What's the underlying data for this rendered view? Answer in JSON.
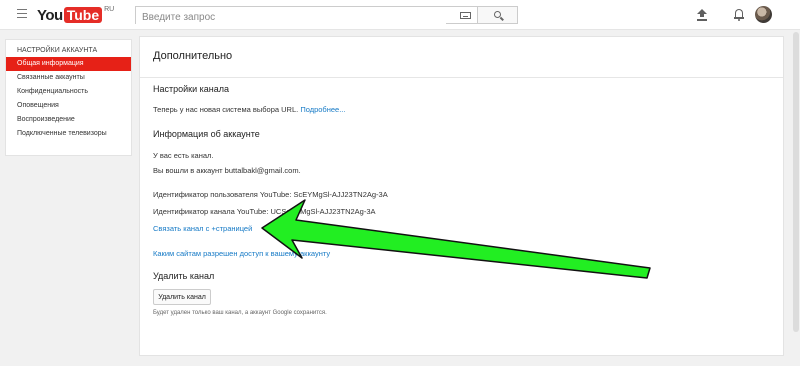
{
  "header": {
    "logo_you": "You",
    "logo_tube": "Tube",
    "logo_region": "RU",
    "search_placeholder": "Введите запрос",
    "icons": [
      "menu-icon",
      "keyboard-icon",
      "search-icon",
      "upload-icon",
      "notifications-icon"
    ]
  },
  "sidebar": {
    "title": "НАСТРОЙКИ АККАУНТА",
    "items": [
      {
        "label": "Общая информация",
        "active": true
      },
      {
        "label": "Связанные аккаунты"
      },
      {
        "label": "Конфиденциальность"
      },
      {
        "label": "Оповещения"
      },
      {
        "label": "Воспроизведение"
      },
      {
        "label": "Подключенные телевизоры"
      }
    ]
  },
  "main": {
    "title": "Дополнительно",
    "channel_settings": {
      "heading": "Настройки канала",
      "text": "Теперь у нас новая система выбора URL.",
      "link": "Подробнее..."
    },
    "account_info": {
      "heading": "Информация об аккаунте",
      "has_channel": "У вас есть канал.",
      "signed_in": "Вы вошли в аккаунт buttalbakl@gmail.com.",
      "user_id": "Идентификатор пользователя YouTube: ScEYMgSl-AJJ23TN2Ag-3A",
      "channel_id": "Идентификатор канала YouTube: UCScEYMgSl-AJJ23TN2Ag-3A",
      "link_channel": "Связать канал с +страницей",
      "sites_access": "Каким сайтам разрешен доступ к вашему аккаунту"
    },
    "delete": {
      "heading": "Удалить канал",
      "button": "Удалить канал",
      "note": "Будет удален только ваш канал, а аккаунт Google сохранится."
    }
  },
  "colors": {
    "accent_red": "#e62117",
    "link_blue": "#167ac6",
    "annotation_green": "#22ee22"
  }
}
